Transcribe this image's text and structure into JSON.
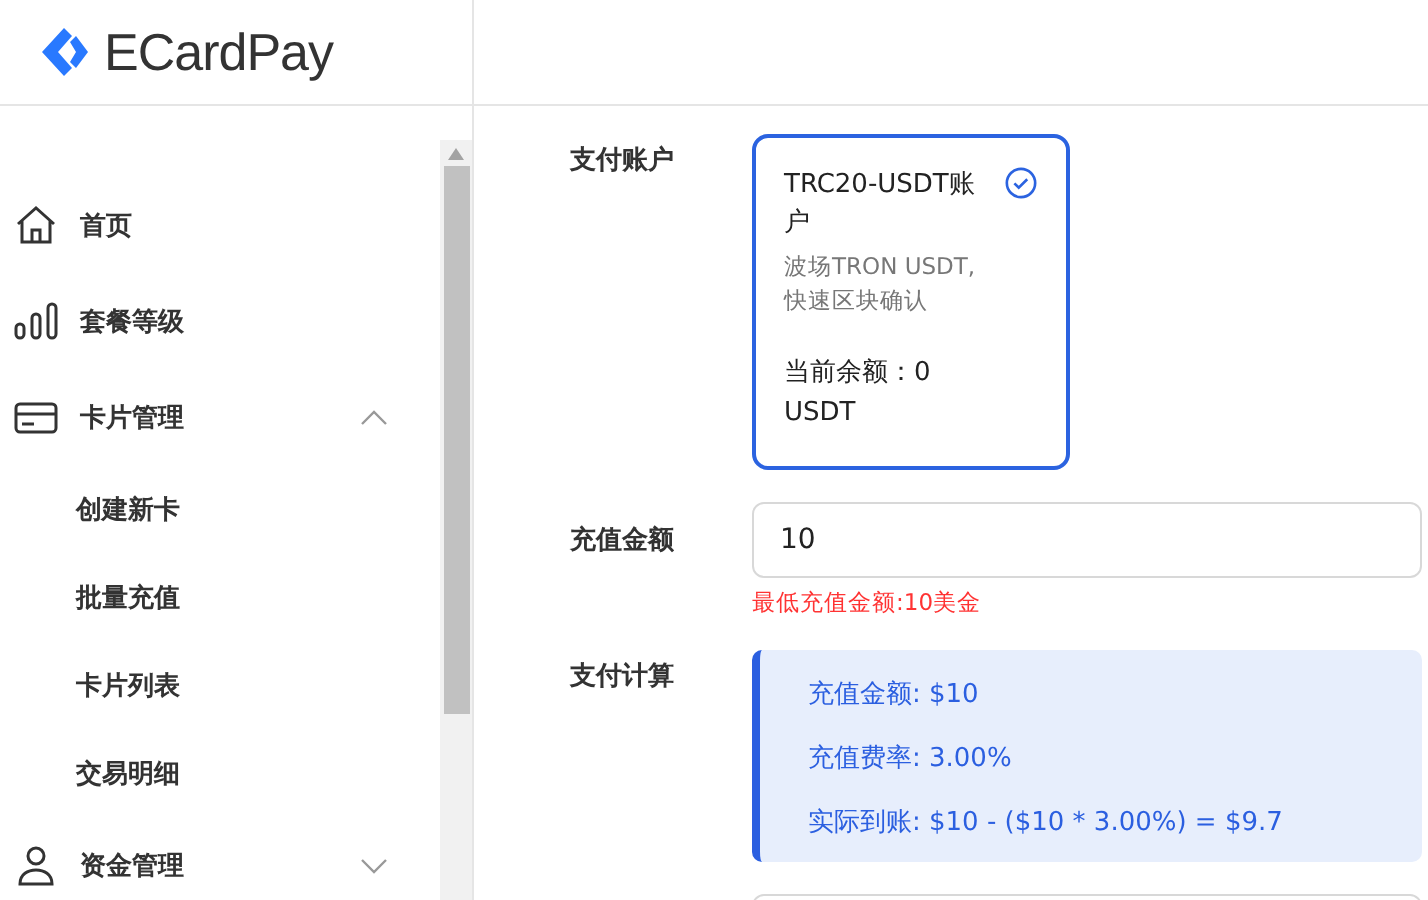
{
  "logo": {
    "text": "ECardPay"
  },
  "sidebar": {
    "items": [
      {
        "label": "首页",
        "kind": "home"
      },
      {
        "label": "套餐等级",
        "kind": "levels"
      },
      {
        "label": "卡片管理",
        "kind": "card",
        "expanded": true,
        "children": [
          {
            "label": "创建新卡"
          },
          {
            "label": "批量充值"
          },
          {
            "label": "卡片列表"
          },
          {
            "label": "交易明细"
          }
        ]
      },
      {
        "label": "资金管理",
        "kind": "user",
        "expanded": false
      }
    ]
  },
  "form": {
    "payment_account": {
      "label": "支付账户",
      "account": {
        "title": "TRC20-USDT账户",
        "description": "波场TRON USDT, 快速区块确认",
        "balance": "当前余额：0 USDT",
        "selected": true
      }
    },
    "amount": {
      "label": "充值金额",
      "value": "10",
      "hint": "最低充值金额:10美金"
    },
    "calculation": {
      "label": "支付计算",
      "lines": [
        "充值金额: $10",
        "充值费率: 3.00%",
        "实际到账: $10 - ($10 * 3.00%) = $9.7"
      ]
    }
  }
}
